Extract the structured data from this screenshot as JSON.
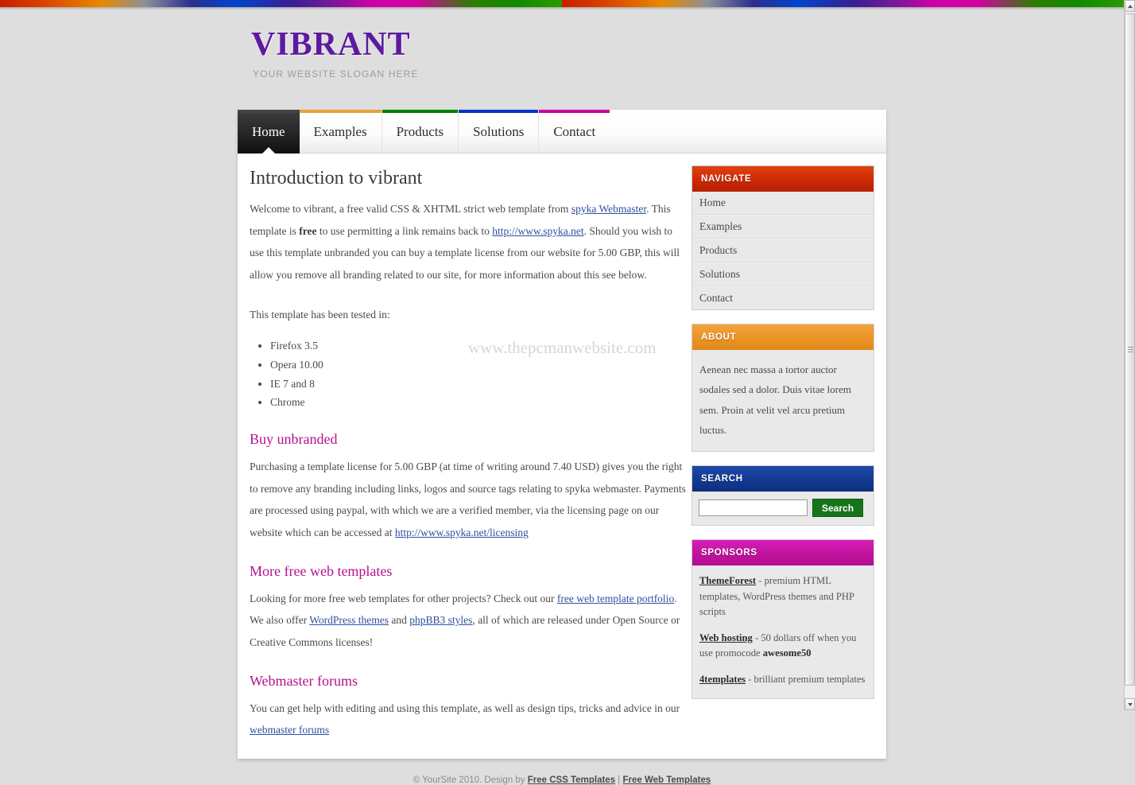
{
  "header": {
    "logo": "VIBRANT",
    "slogan": "YOUR WEBSITE SLOGAN HERE"
  },
  "nav": {
    "items": [
      {
        "label": "Home",
        "color": "#444444",
        "active": true
      },
      {
        "label": "Examples",
        "color": "#e8a33d",
        "active": false
      },
      {
        "label": "Products",
        "color": "#008000",
        "active": false
      },
      {
        "label": "Solutions",
        "color": "#0033cc",
        "active": false
      },
      {
        "label": "Contact",
        "color": "#cc0099",
        "active": false
      }
    ]
  },
  "content": {
    "title": "Introduction to vibrant",
    "intro_p1_a": "Welcome to vibrant, a free valid CSS & XHTML strict web template from ",
    "intro_link1": "spyka Webmaster",
    "intro_p1_b": ". This template is ",
    "intro_bold": "free",
    "intro_p1_c": " to use permitting a link remains back to ",
    "intro_link2": "http://www.spyka.net",
    "intro_p1_d": ". Should you wish to use this template unbranded you can buy a template license from our website for 5.00 GBP, this will allow you remove all branding related to our site, for more information about this see below.",
    "tested_intro": "This template has been tested in:",
    "tested_list": [
      "Firefox 3.5",
      "Opera 10.00",
      "IE 7 and 8",
      "Chrome"
    ],
    "watermark": "www.thepcmanwebsite.com",
    "sections": [
      {
        "title": "Buy unbranded",
        "text_a": "Purchasing a template license for 5.00 GBP (at time of writing around 7.40 USD) gives you the right to remove any branding including links, logos and source tags relating to spyka webmaster. Payments are processed using paypal, with which we are a verified member, via the licensing page on our website which can be accessed at ",
        "link": "http://www.spyka.net/licensing",
        "text_b": ""
      }
    ],
    "templates_title": "More free web templates",
    "templates_a": "Looking for more free web templates for other projects? Check out our ",
    "templates_link1": "free web template portfolio",
    "templates_b": ". We also offer ",
    "templates_link2": "WordPress themes",
    "templates_c": " and ",
    "templates_link3": "phpBB3 styles",
    "templates_d": ", all of which are released under Open Source or Creative Commons licenses!",
    "forums_title": "Webmaster forums",
    "forums_a": "You can get help with editing and using this template, as well as design tips, tricks and advice in our ",
    "forums_link": "webmaster forums"
  },
  "sidebar": {
    "navigate": {
      "heading": "NAVIGATE",
      "color": "#cf2a06",
      "items": [
        "Home",
        "Examples",
        "Products",
        "Solutions",
        "Contact"
      ]
    },
    "about": {
      "heading": "ABOUT",
      "color": "#ec9526",
      "text": "Aenean nec massa a tortor auctor sodales sed a dolor. Duis vitae lorem sem. Proin at velit vel arcu pretium luctus."
    },
    "search": {
      "heading": "SEARCH",
      "color": "#133b93",
      "value": "",
      "placeholder": "",
      "button": "Search",
      "button_color": "#16751b"
    },
    "sponsors": {
      "heading": "SPONSORS",
      "color": "#c3139f",
      "items": [
        {
          "link": "ThemeForest",
          "text_a": " - premium HTML templates, WordPress themes and PHP scripts",
          "bold": "",
          "text_b": ""
        },
        {
          "link": "Web hosting",
          "text_a": " - 50 dollars off when you use promocode ",
          "bold": "awesome50",
          "text_b": ""
        },
        {
          "link": "4templates",
          "text_a": " - brilliant premium templates",
          "bold": "",
          "text_b": ""
        }
      ]
    }
  },
  "footer": {
    "copyright": "© YourSite 2010. Design by ",
    "link1": "Free CSS Templates",
    "separator": " | ",
    "link2": "Free Web Templates"
  }
}
